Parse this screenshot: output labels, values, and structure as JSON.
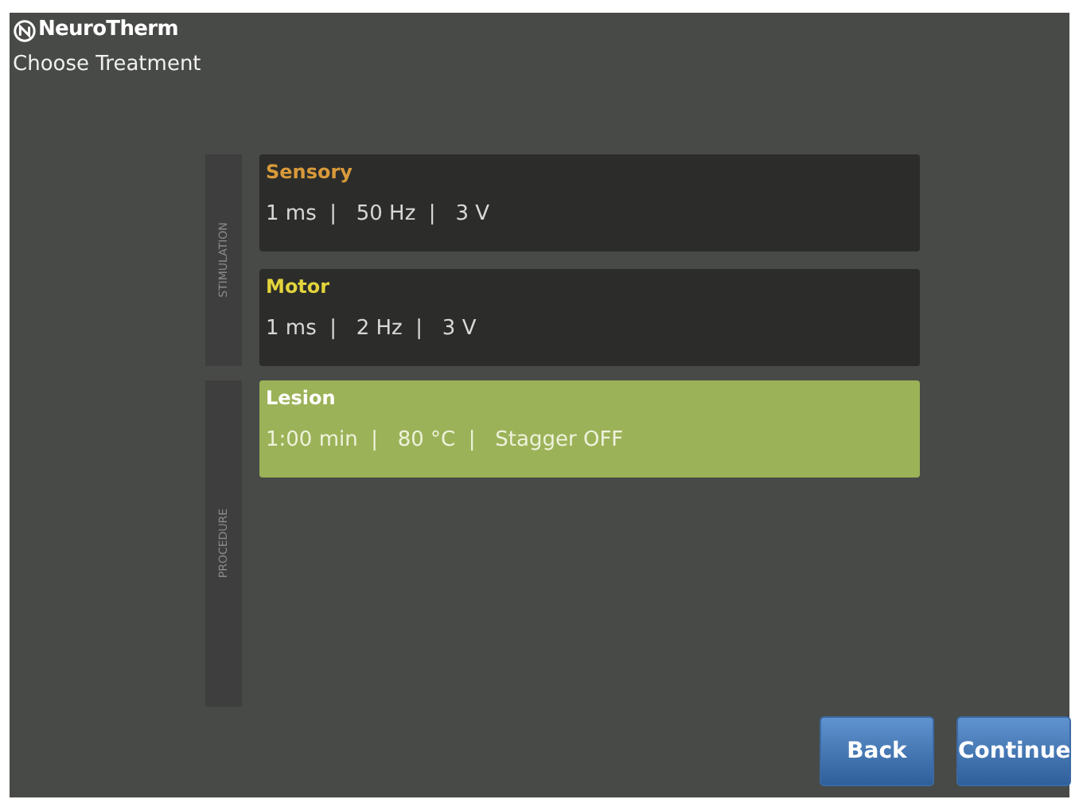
{
  "header": {
    "logo": "NeuroTherm",
    "title": "Choose Treatment"
  },
  "groups": [
    {
      "label": "STIMULATION",
      "items": [
        {
          "name": "Sensory",
          "color": "#d99a3a",
          "settings": "1 ms  |   50 Hz  |   3 V",
          "selected": false
        },
        {
          "name": "Motor",
          "color": "#e3d43c",
          "settings": "1 ms  |   2 Hz  |   3 V",
          "selected": false
        }
      ]
    },
    {
      "label": "PROCEDURE",
      "items": [
        {
          "name": "Lesion",
          "color": "#ffffff",
          "settings": "1:00 min  |   80 °C  |   Stagger OFF",
          "selected": true
        }
      ]
    }
  ],
  "buttons": [
    "Back",
    "Continue"
  ]
}
